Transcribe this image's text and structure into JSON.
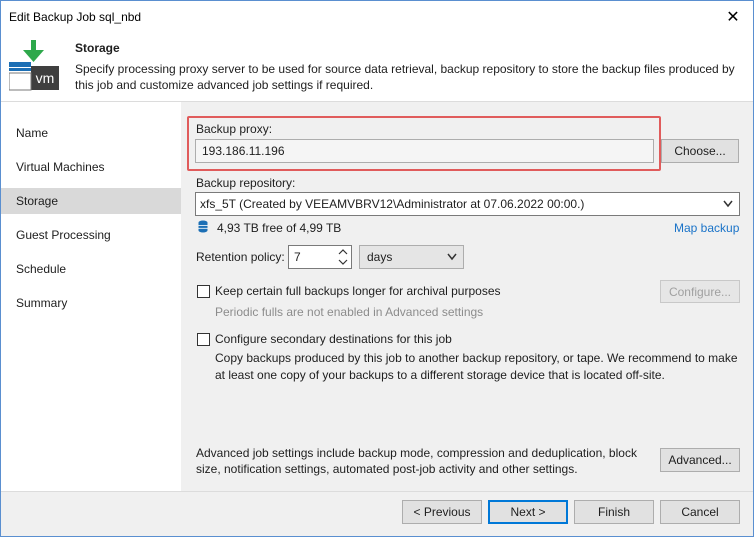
{
  "window": {
    "title": "Edit Backup Job sql_nbd",
    "close_symbol": "✕"
  },
  "header": {
    "icon": "vm-backup-icon",
    "icon_text": "vm",
    "title": "Storage",
    "description": "Specify processing proxy server to be used for source data retrieval, backup repository to store the backup files produced by this job and customize advanced job settings if required."
  },
  "sidebar": {
    "items": [
      {
        "label": "Name"
      },
      {
        "label": "Virtual Machines"
      },
      {
        "label": "Storage"
      },
      {
        "label": "Guest Processing"
      },
      {
        "label": "Schedule"
      },
      {
        "label": "Summary"
      }
    ],
    "active_index": 2
  },
  "proxy": {
    "label": "Backup proxy:",
    "value": "193.186.11.196",
    "choose_label": "Choose..."
  },
  "repository": {
    "label": "Backup repository:",
    "selected": "xfs_5T (Created by VEEAMVBRV12\\Administrator at 07.06.2022 00:00.)",
    "free_space": "4,93 TB free of 4,99 TB",
    "map_label": "Map backup"
  },
  "retention": {
    "label": "Retention policy:",
    "value": "7",
    "unit": "days"
  },
  "archival": {
    "label": "Keep certain full backups longer for archival purposes",
    "hint": "Periodic fulls are not enabled in Advanced settings",
    "configure_label": "Configure...",
    "checked": false
  },
  "secondary": {
    "label": "Configure secondary destinations for this job",
    "description": "Copy backups produced by this job to another backup repository, or tape. We recommend to make at least one copy of your backups to a different storage device that is located off-site.",
    "checked": false
  },
  "advanced": {
    "description": "Advanced job settings include backup mode, compression and deduplication, block size, notification settings, automated post-job activity and other settings.",
    "button_label": "Advanced..."
  },
  "footer": {
    "previous": "< Previous",
    "next": "Next >",
    "finish": "Finish",
    "cancel": "Cancel"
  },
  "colors": {
    "highlight_frame": "#e05b5b",
    "link": "#1a73c8",
    "nav_active": "#d9d9d9",
    "icon_green": "#2ea84b"
  }
}
